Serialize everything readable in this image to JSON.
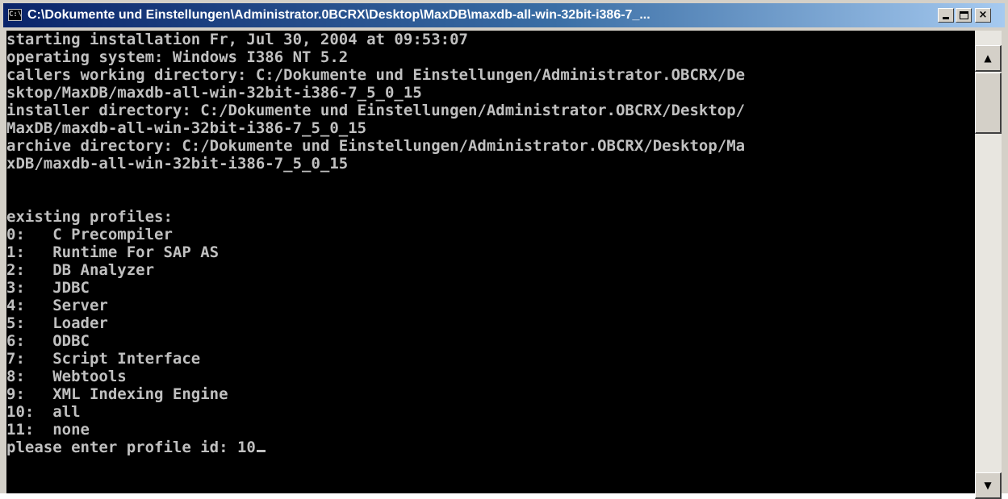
{
  "window": {
    "title": "C:\\Dokumente und Einstellungen\\Administrator.0BCRX\\Desktop\\MaxDB\\maxdb-all-win-32bit-i386-7_...",
    "icon": "console-icon",
    "icon_label": "C:\\",
    "buttons": {
      "minimize": "minimize-icon",
      "maximize": "maximize-icon",
      "close": "×"
    }
  },
  "console": {
    "lines": [
      "starting installation Fr, Jul 30, 2004 at 09:53:07",
      "operating system: Windows I386 NT 5.2",
      "callers working directory: C:/Dokumente und Einstellungen/Administrator.OBCRX/De",
      "sktop/MaxDB/maxdb-all-win-32bit-i386-7_5_0_15",
      "installer directory: C:/Dokumente und Einstellungen/Administrator.OBCRX/Desktop/",
      "MaxDB/maxdb-all-win-32bit-i386-7_5_0_15",
      "archive directory: C:/Dokumente und Einstellungen/Administrator.OBCRX/Desktop/Ma",
      "xDB/maxdb-all-win-32bit-i386-7_5_0_15",
      "",
      "",
      "existing profiles:",
      "0:   C Precompiler",
      "1:   Runtime For SAP AS",
      "2:   DB Analyzer",
      "3:   JDBC",
      "4:   Server",
      "5:   Loader",
      "6:   ODBC",
      "7:   Script Interface",
      "8:   Webtools",
      "9:   XML Indexing Engine",
      "10:  all",
      "11:  none"
    ],
    "prompt": "please enter profile id: ",
    "input_value": "10"
  },
  "scrollbar": {
    "up": "▲",
    "down": "▼"
  },
  "colors": {
    "console_bg": "#000000",
    "console_fg": "#c0c0c0",
    "titlebar_start": "#0a246a",
    "titlebar_end": "#a6caf0",
    "chrome": "#d4d0c8"
  }
}
